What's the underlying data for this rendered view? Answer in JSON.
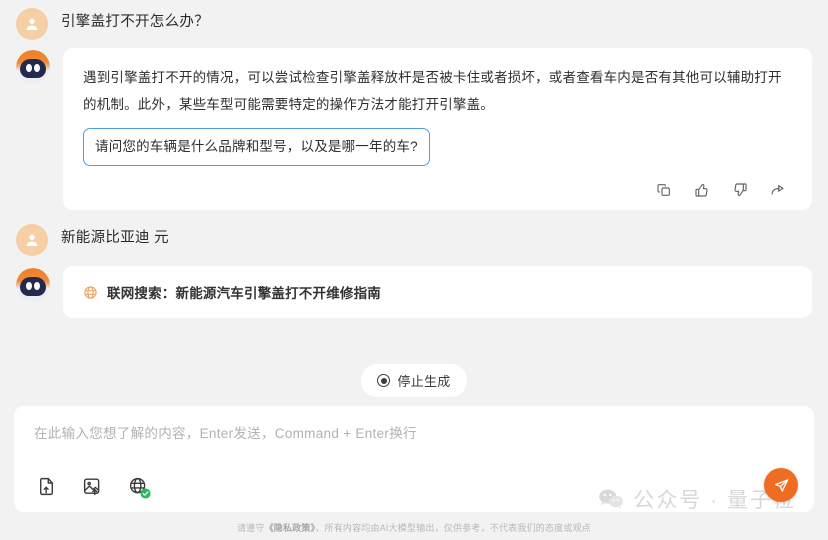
{
  "conversation": {
    "messages": [
      {
        "role": "user",
        "text": "引擎盖打不开怎么办？"
      },
      {
        "role": "assistant",
        "paragraph": "遇到引擎盖打不开的情况，可以尝试检查引擎盖释放杆是否被卡住或者损坏，或者查看车内是否有其他可以辅助打开的机制。此外，某些车型可能需要特定的操作方法才能打开引擎盖。",
        "highlight": "请问您的车辆是什么品牌和型号，以及是哪一年的车?"
      },
      {
        "role": "user",
        "text": "新能源比亚迪 元"
      },
      {
        "role": "assistant",
        "search_label": "联网搜索：新能源汽车引擎盖打不开维修指南"
      }
    ],
    "actions": [
      {
        "name": "copy-icon",
        "label": "复制"
      },
      {
        "name": "thumbs-up-icon",
        "label": "赞"
      },
      {
        "name": "thumbs-down-icon",
        "label": "踩"
      },
      {
        "name": "share-icon",
        "label": "分享"
      }
    ]
  },
  "stop_button": {
    "label": "停止生成",
    "icon": "stop-record-icon"
  },
  "composer": {
    "placeholder": "在此输入您想了解的内容，Enter发送，Command + Enter换行",
    "value": "",
    "tools": [
      {
        "name": "file-upload-icon",
        "label": "上传文件"
      },
      {
        "name": "image-upload-icon",
        "label": "上传图片"
      },
      {
        "name": "web-search-toggle-icon",
        "label": "联网搜索"
      }
    ],
    "send_button": {
      "name": "send-icon",
      "label": "发送"
    }
  },
  "watermark": {
    "icon": "wechat-icon",
    "text": "公众号 · 量子位"
  },
  "footer": {
    "prefix": "请遵守",
    "policy_link": "《隐私政策》",
    "suffix": "，所有内容均由AI大模型输出，仅供参考，不代表我们的态度或观点"
  },
  "colors": {
    "page_bg": "#f2f2f2",
    "bubble_bg": "#ffffff",
    "accent_orange": "#ef6c23",
    "highlight_border": "#4f9fe0",
    "user_avatar_bg": "#f7cfa6",
    "search_icon": "#e8a15c",
    "globe_check": "#2eb85c"
  }
}
